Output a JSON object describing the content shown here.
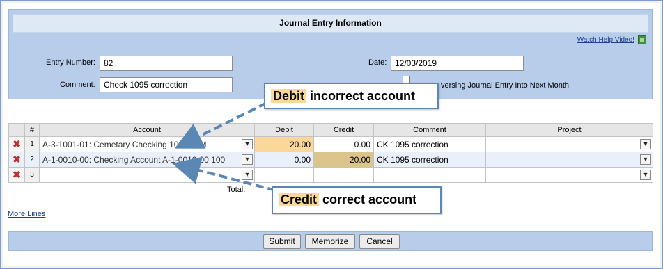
{
  "header": {
    "title": "Journal Entry Information",
    "help_link": "Watch Help Video!"
  },
  "form": {
    "entry_number_label": "Entry Number:",
    "entry_number_value": "82",
    "comment_label": "Comment:",
    "comment_value": "Check 1095 correction",
    "date_label": "Date:",
    "date_value": "12/03/2019",
    "reversing_label": "versing Journal Entry Into Next Month"
  },
  "grid": {
    "columns": [
      "#",
      "Account",
      "Debit",
      "Credit",
      "Comment",
      "Project"
    ],
    "rows": [
      {
        "num": "1",
        "account": "A-3-1001-01: Cemetary Checking 1001CEM",
        "debit": "20.00",
        "credit": "0.00",
        "comment": "CK 1095 correction"
      },
      {
        "num": "2",
        "account": "A-1-0010-00: Checking Account A-1-0010-00 100",
        "debit": "0.00",
        "credit": "20.00",
        "comment": "CK 1095 correction"
      },
      {
        "num": "3",
        "account": "",
        "debit": "",
        "credit": "",
        "comment": ""
      }
    ],
    "total_label": "Total:"
  },
  "more_lines": "More Lines",
  "buttons": {
    "submit": "Submit",
    "memorize": "Memorize",
    "cancel": "Cancel"
  },
  "callouts": {
    "debit_word": "Debit",
    "debit_rest": " incorrect account",
    "credit_word": "Credit",
    "credit_rest": " correct account"
  },
  "colors": {
    "panel": "#b8cdea",
    "debit_highlight": "#fbd79a",
    "credit_highlight": "#dcc58d",
    "callout_border": "#5b87b5",
    "arrow": "#5b87b5"
  }
}
